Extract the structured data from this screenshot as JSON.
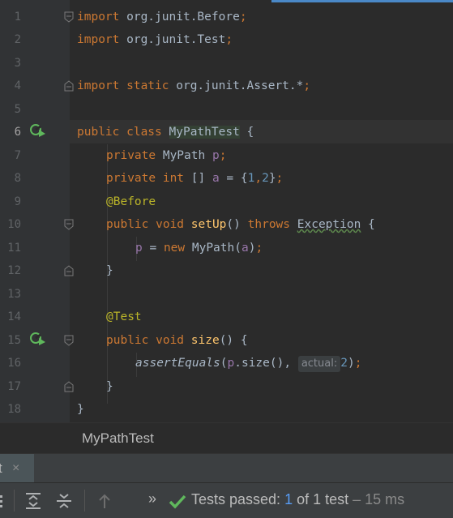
{
  "editor": {
    "line_numbers": [
      "1",
      "2",
      "3",
      "4",
      "5",
      "6",
      "7",
      "8",
      "9",
      "10",
      "11",
      "12",
      "13",
      "14",
      "15",
      "16",
      "17",
      "18"
    ],
    "code": {
      "l1": {
        "kw": "import",
        "rest": " org.junit.",
        "cls": "Before",
        "semi": ";"
      },
      "l2": {
        "kw": "import",
        "rest": " org.junit.",
        "cls": "Test",
        "semi": ";"
      },
      "l4": {
        "kw": "import static",
        "rest": " org.junit.Assert.*",
        "semi": ";"
      },
      "l6": {
        "kw": "public class",
        "cls": "MyPathTest",
        "rest": " {"
      },
      "l7": {
        "kw": "private",
        "ty": " MyPath ",
        "fld": "p",
        "semi": ";"
      },
      "l8": {
        "kw": "private int",
        "ty": " [] ",
        "fld": "a",
        "eq": " = {",
        "n1": "1",
        "comma": ",",
        "n2": "2",
        "end": "}",
        "semi": ";"
      },
      "l9": {
        "ann": "@Before"
      },
      "l10": {
        "kw": "public void",
        "fn": " setUp",
        "paren": "() ",
        "kw2": "throws",
        "sp": " ",
        "exc": "Exception",
        "brace": " {"
      },
      "l11": {
        "fld": "p",
        "eq": " = ",
        "kw": "new",
        "ty": " MyPath(",
        "fld2": "a",
        "end": ")",
        "semi": ";"
      },
      "l12": {
        "brace": "}"
      },
      "l14": {
        "ann": "@Test"
      },
      "l15": {
        "kw": "public void",
        "fn": " size",
        "rest": "() {"
      },
      "l16": {
        "fn": "assertEquals",
        "open": "(",
        "fld": "p",
        "mid": ".size(), ",
        "hint": "actual:",
        "num": "2",
        "end": ")",
        "semi": ";"
      },
      "l17": {
        "brace": "}"
      },
      "l18": {
        "brace": "}"
      }
    }
  },
  "breadcrumb": "MyPathTest",
  "run_panel": {
    "tab_label": "t",
    "close_glyph": "×",
    "status_prefix": "Tests passed: ",
    "status_count": "1",
    "status_mid": " of 1 test",
    "status_time": " – 15 ms",
    "more_glyph": "»"
  },
  "colors": {
    "editor_bg": "#2b2b2b",
    "keyword": "#cc7832",
    "pass_green": "#5fb85c"
  }
}
